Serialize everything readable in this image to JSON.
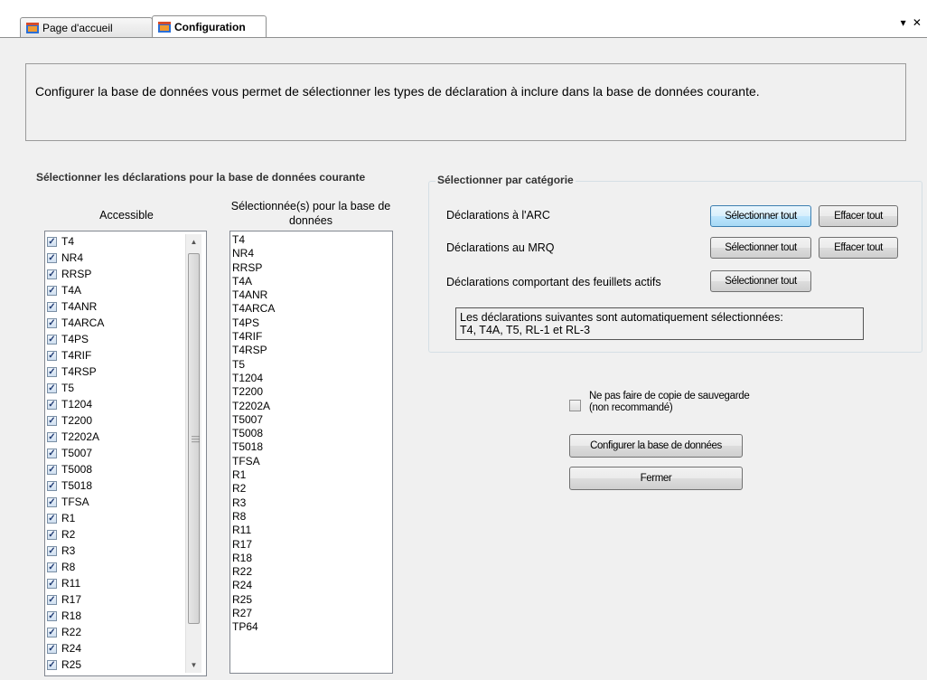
{
  "tabs": [
    {
      "label": "Page d'accueil",
      "active": false
    },
    {
      "label": "Configuration",
      "active": true
    }
  ],
  "window_controls": "▾ ✕",
  "description": "Configurer la base de données vous permet de sélectionner les types de déclaration à inclure dans la base de données courante.",
  "declarations_group": {
    "title": "Sélectionner les déclarations pour la base de données courante",
    "accessible_header": "Accessible",
    "selected_header": "Sélectionnée(s) pour la base de données",
    "accessible_items": [
      "T4",
      "NR4",
      "RRSP",
      "T4A",
      "T4ANR",
      "T4ARCA",
      "T4PS",
      "T4RIF",
      "T4RSP",
      "T5",
      "T1204",
      "T2200",
      "T2202A",
      "T5007",
      "T5008",
      "T5018",
      "TFSA",
      "R1",
      "R2",
      "R3",
      "R8",
      "R11",
      "R17",
      "R18",
      "R22",
      "R24",
      "R25"
    ],
    "accessible_checked": true,
    "selected_items": [
      "T4",
      "NR4",
      "RRSP",
      "T4A",
      "T4ANR",
      "T4ARCA",
      "T4PS",
      "T4RIF",
      "T4RSP",
      "T5",
      "T1204",
      "T2200",
      "T2202A",
      "T5007",
      "T5008",
      "T5018",
      "TFSA",
      "R1",
      "R2",
      "R3",
      "R8",
      "R11",
      "R17",
      "R18",
      "R22",
      "R24",
      "R25",
      "R27",
      "TP64"
    ]
  },
  "category_group": {
    "title": "Sélectionner par catégorie",
    "rows": [
      {
        "label": "Déclarations à l'ARC",
        "select_all": "Sélectionner tout",
        "clear_all": "Effacer tout"
      },
      {
        "label": "Déclarations au MRQ",
        "select_all": "Sélectionner tout",
        "clear_all": "Effacer tout"
      },
      {
        "label": "Déclarations comportant des feuillets actifs",
        "select_all": "Sélectionner tout"
      }
    ],
    "auto_note_line1": "Les déclarations suivantes sont automatiquement sélectionnées:",
    "auto_note_line2": "T4, T4A, T5, RL-1 et RL-3"
  },
  "backup": {
    "label_line1": "Ne pas faire de copie de sauvegarde",
    "label_line2": "(non recommandé)",
    "checked": false
  },
  "buttons": {
    "configure": "Configurer la base de données",
    "close": "Fermer"
  },
  "colors": {
    "window_bg": "#f0f0f0",
    "focus_border": "#3c7fb1",
    "checkbox_mark": "#1f3b73"
  }
}
